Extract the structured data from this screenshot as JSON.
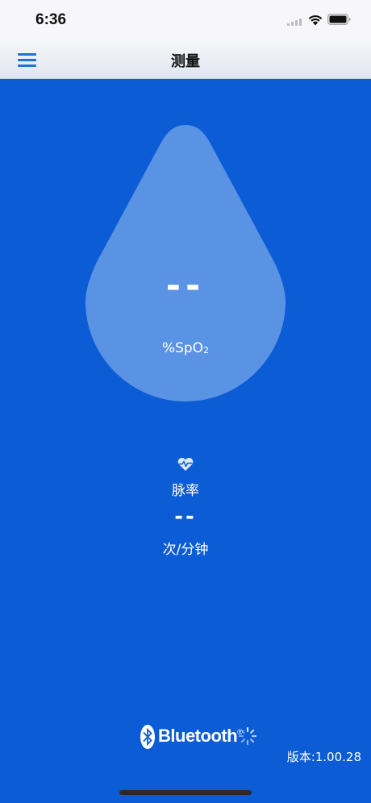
{
  "status_bar": {
    "time": "6:36",
    "signal_icon": "cellular-signal-icon",
    "wifi_icon": "wifi-icon",
    "battery_icon": "battery-icon"
  },
  "nav": {
    "title": "测量",
    "menu_icon": "hamburger-menu-icon"
  },
  "measurement": {
    "spo2_value": "--",
    "spo2_unit_main": "%SpO",
    "spo2_unit_sub": "2",
    "pulse_label": "脉率",
    "pulse_value": "--",
    "pulse_unit": "次/分钟",
    "heart_icon": "heart-pulse-icon"
  },
  "bluetooth": {
    "label": "Bluetooth",
    "reg_mark": "®",
    "status_icon": "loading-spinner-icon"
  },
  "version": "版本:1.00.28",
  "colors": {
    "background": "#0b5cd5",
    "drop": "#5a92e4",
    "accent": "#1d72d8"
  }
}
